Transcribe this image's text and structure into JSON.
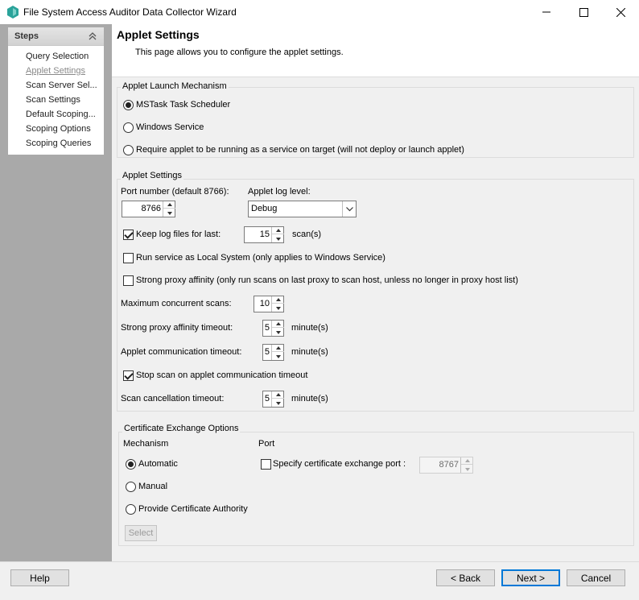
{
  "window": {
    "title": "File System Access Auditor Data Collector Wizard",
    "controls": [
      "minimize",
      "maximize",
      "close"
    ]
  },
  "sidebar": {
    "title": "Steps",
    "items": [
      {
        "label": "Query Selection",
        "current": false
      },
      {
        "label": "Applet Settings",
        "current": true
      },
      {
        "label": "Scan Server Sel...",
        "current": false
      },
      {
        "label": "Scan Settings",
        "current": false
      },
      {
        "label": "Default Scoping...",
        "current": false
      },
      {
        "label": "Scoping Options",
        "current": false
      },
      {
        "label": "Scoping Queries",
        "current": false
      }
    ]
  },
  "header": {
    "title": "Applet Settings",
    "description": "This page allows you to configure the applet settings."
  },
  "launch": {
    "group_label": "Applet Launch Mechanism",
    "options": [
      {
        "label": "MSTask Task Scheduler",
        "selected": true
      },
      {
        "label": "Windows Service",
        "selected": false
      },
      {
        "label": "Require applet to be running as a service on target (will not deploy or launch applet)",
        "selected": false
      }
    ]
  },
  "settings": {
    "group_label": "Applet Settings",
    "port_label": "Port number (default 8766):",
    "port_value": "8766",
    "log_level_label": "Applet log level:",
    "log_level_value": "Debug",
    "keep_logs_label": "Keep log files for last:",
    "keep_logs_checked": true,
    "keep_logs_value": "15",
    "keep_logs_unit": "scan(s)",
    "local_system_label": "Run service as Local System (only applies to Windows Service)",
    "local_system_checked": false,
    "strong_affinity_label": "Strong proxy affinity (only run scans on last proxy to scan host, unless no longer in proxy host list)",
    "strong_affinity_checked": false,
    "max_scans_label": "Maximum concurrent scans:",
    "max_scans_value": "10",
    "affinity_timeout_label": "Strong proxy affinity timeout:",
    "affinity_timeout_value": "5",
    "affinity_timeout_unit": "minute(s)",
    "comm_timeout_label": "Applet communication timeout:",
    "comm_timeout_value": "5",
    "comm_timeout_unit": "minute(s)",
    "stop_scan_label": "Stop scan on applet communication timeout",
    "stop_scan_checked": true,
    "cancel_timeout_label": "Scan cancellation timeout:",
    "cancel_timeout_value": "5",
    "cancel_timeout_unit": "minute(s)"
  },
  "certificate": {
    "group_label": "Certificate Exchange Options",
    "mechanism_label": "Mechanism",
    "port_label": "Port",
    "options": [
      {
        "label": "Automatic",
        "selected": true
      },
      {
        "label": "Manual",
        "selected": false
      },
      {
        "label": "Provide Certificate Authority",
        "selected": false
      }
    ],
    "specify_port_label": "Specify certificate exchange port :",
    "specify_port_checked": false,
    "port_value": "8767",
    "select_button": "Select"
  },
  "footer": {
    "help": "Help",
    "back": "< Back",
    "next": "Next >",
    "cancel": "Cancel"
  },
  "colors": {
    "sidebar_bg": "#a9a9a9",
    "accent": "#0078d7",
    "logo": "#2aa39a"
  }
}
